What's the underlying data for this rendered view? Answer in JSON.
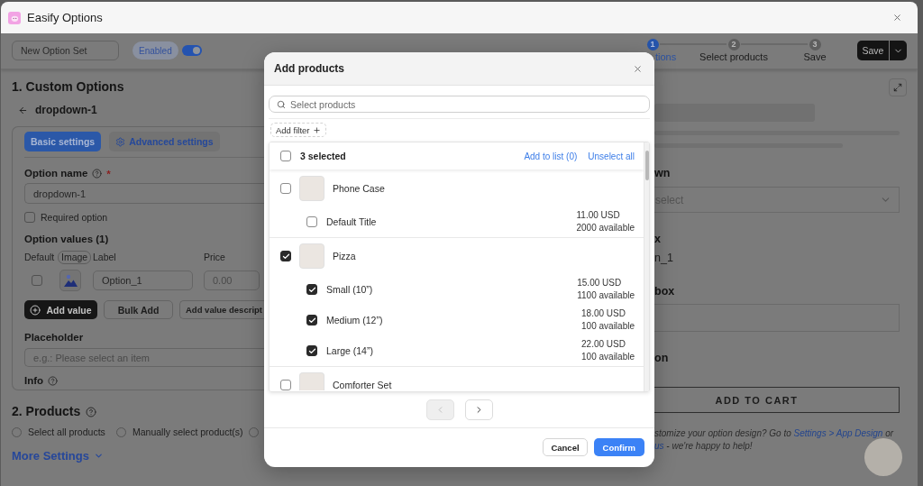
{
  "window": {
    "title": "Easify Options"
  },
  "toolbar": {
    "option_set_name": "New Option Set",
    "status_badge": "Enabled",
    "enabled": true,
    "steps": [
      {
        "number": "1",
        "label": "tions",
        "selected": true
      },
      {
        "number": "2",
        "label": "Select products",
        "selected": false
      },
      {
        "number": "3",
        "label": "Save",
        "selected": false
      }
    ],
    "save_button": "Save"
  },
  "custom_options": {
    "heading": "1. Custom Options",
    "back_label": "dropdown-1",
    "tabs": [
      {
        "label": "Basic settings",
        "selected": true,
        "kind": "plain"
      },
      {
        "label": "Advanced settings",
        "selected": false,
        "kind": "gear"
      }
    ],
    "option_name": {
      "label": "Option name",
      "required_mark": "*",
      "value": "dropdown-1"
    },
    "required_option": {
      "label": "Required option",
      "checked": false
    },
    "option_values": {
      "heading": "Option values (1)",
      "columns": [
        {
          "label": "Default",
          "kind": "text"
        },
        {
          "label": "Image",
          "kind": "chip"
        },
        {
          "label": "Label",
          "kind": "text"
        },
        {
          "label": "Price",
          "kind": "text"
        }
      ],
      "rows": [
        {
          "default": false,
          "label": "Option_1",
          "price": {
            "placeholder": "0.00"
          }
        }
      ]
    },
    "buttons": [
      {
        "kind": "add",
        "label": "Add value"
      },
      {
        "kind": "outline",
        "label": "Bulk Add"
      },
      {
        "kind": "outline",
        "label": "Add value descript"
      }
    ],
    "placeholder_field": {
      "label": "Placeholder",
      "placeholder": "e.g.: Please select an item"
    },
    "info_label": "Info"
  },
  "products": {
    "heading": "2. Products",
    "options": [
      {
        "label": "Select all products",
        "selected": false
      },
      {
        "label": "Manually select product(s)",
        "selected": false
      },
      {
        "selected": false
      }
    ]
  },
  "more_settings": "More Settings",
  "preview": {
    "fields": [
      {
        "kind": "select",
        "label": "wn",
        "placeholder": "select"
      },
      {
        "kind": "value",
        "label": "x",
        "value": "n_1"
      },
      {
        "kind": "input",
        "label": "box"
      },
      {
        "kind": "label",
        "label": "on"
      }
    ],
    "cart_button": "ADD TO CART",
    "help_lines": [
      [
        {
          "kind": "text",
          "text": "stomize your option design? Go to"
        },
        {
          "kind": "link",
          "text": "Settings > App Design"
        },
        {
          "kind": "text",
          "text": "or"
        }
      ],
      [
        {
          "kind": "link",
          "text": "us"
        },
        {
          "kind": "text",
          "text": "- we're happy to help!"
        }
      ]
    ]
  },
  "dialog": {
    "title": "Add products",
    "search": {
      "placeholder": "Select products"
    },
    "filter_button": "Add filter",
    "list_header": {
      "checked": false,
      "selected_count": "3 selected",
      "actions": [
        "Add to list (0)",
        "Unselect all"
      ]
    },
    "products": [
      {
        "name": "Phone Case",
        "checked": false,
        "variants": [
          {
            "name": "Default Title",
            "checked": false,
            "price": "11.00 USD",
            "stock": "2000 available"
          }
        ]
      },
      {
        "name": "Pizza",
        "checked": true,
        "variants": [
          {
            "name": "Small (10”)",
            "checked": true,
            "price": "15.00 USD",
            "stock": "1100 available"
          },
          {
            "name": "Medium (12”)",
            "checked": true,
            "price": "18.00 USD",
            "stock": "100 available"
          },
          {
            "name": "Large (14”)",
            "checked": true,
            "price": "22.00 USD",
            "stock": "100 available"
          }
        ]
      },
      {
        "name": "Comforter Set",
        "checked": false
      }
    ],
    "pagination": [
      {
        "kind": "previous",
        "disabled": true
      },
      {
        "kind": "next",
        "disabled": false
      }
    ],
    "buttons": [
      {
        "kind": "secondary",
        "label": "Cancel"
      },
      {
        "kind": "primary",
        "label": "Confirm"
      }
    ]
  }
}
